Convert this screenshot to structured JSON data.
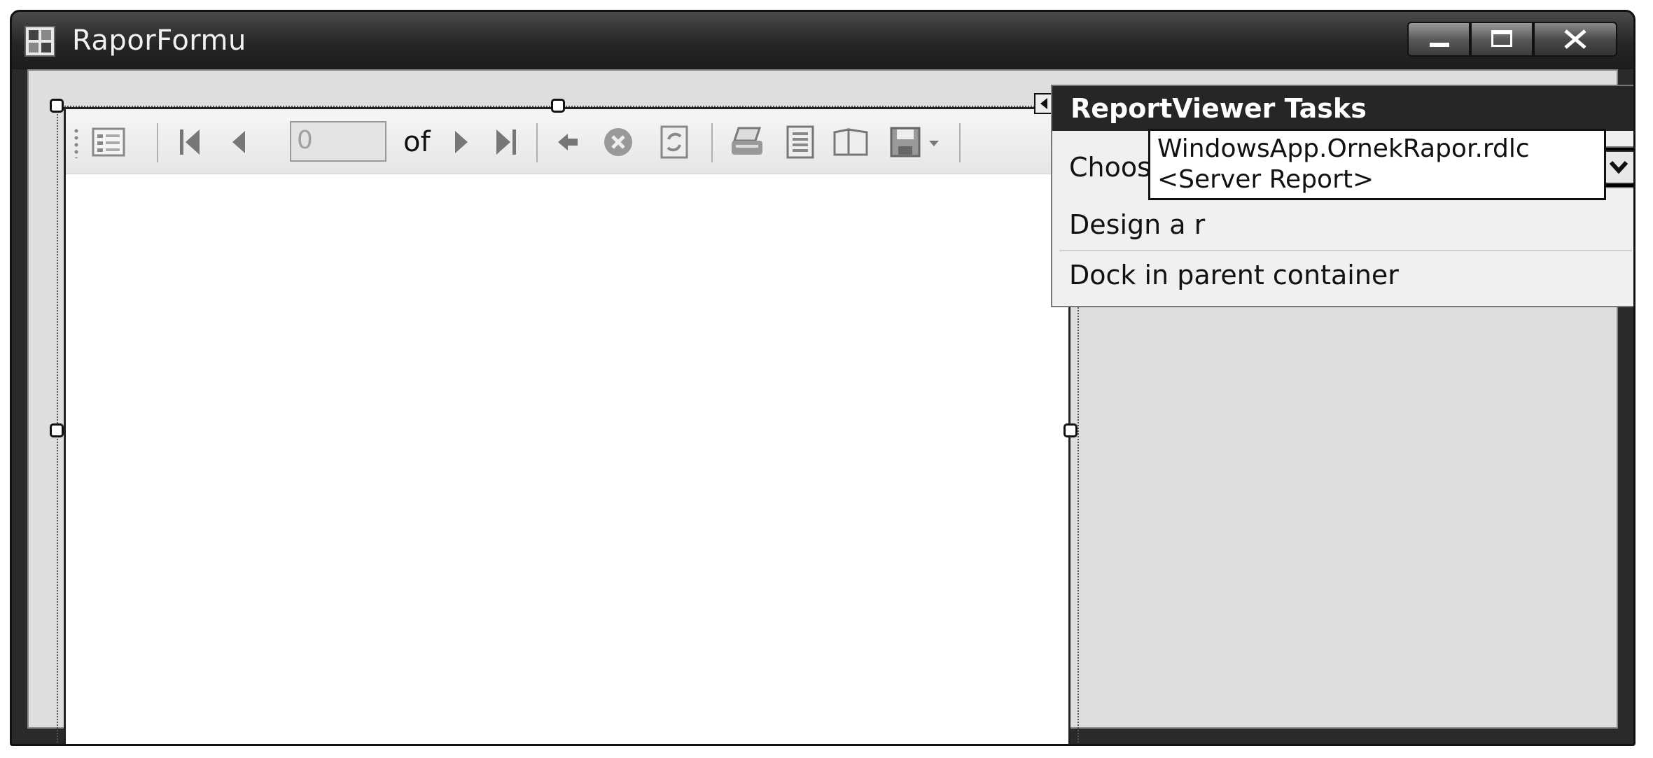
{
  "window": {
    "title": "RaporFormu",
    "controls": {
      "minimize_icon": "minimize-icon",
      "maximize_icon": "maximize-icon",
      "close_icon": "close-icon"
    }
  },
  "report_viewer": {
    "toolbar": {
      "page_input_value": "0",
      "of_label": "of",
      "icons": [
        "document-map-icon",
        "first-page-icon",
        "previous-page-icon",
        "next-page-icon",
        "last-page-icon",
        "back-icon",
        "stop-icon",
        "refresh-icon",
        "print-icon",
        "print-layout-icon",
        "page-setup-icon",
        "export-icon"
      ]
    }
  },
  "tasks_panel": {
    "header": "ReportViewer Tasks",
    "choose_report_label": "Choose Report",
    "choose_report_value": "",
    "design_label_visible": "Design a r",
    "dock_label": "Dock in parent container",
    "dropdown_options": [
      "WindowsApp.OrnekRapor.rdlc",
      "<Server Report>"
    ]
  },
  "colors": {
    "titlebar": "#262626",
    "client_bg": "#dedede",
    "tasks_header": "#262626"
  }
}
